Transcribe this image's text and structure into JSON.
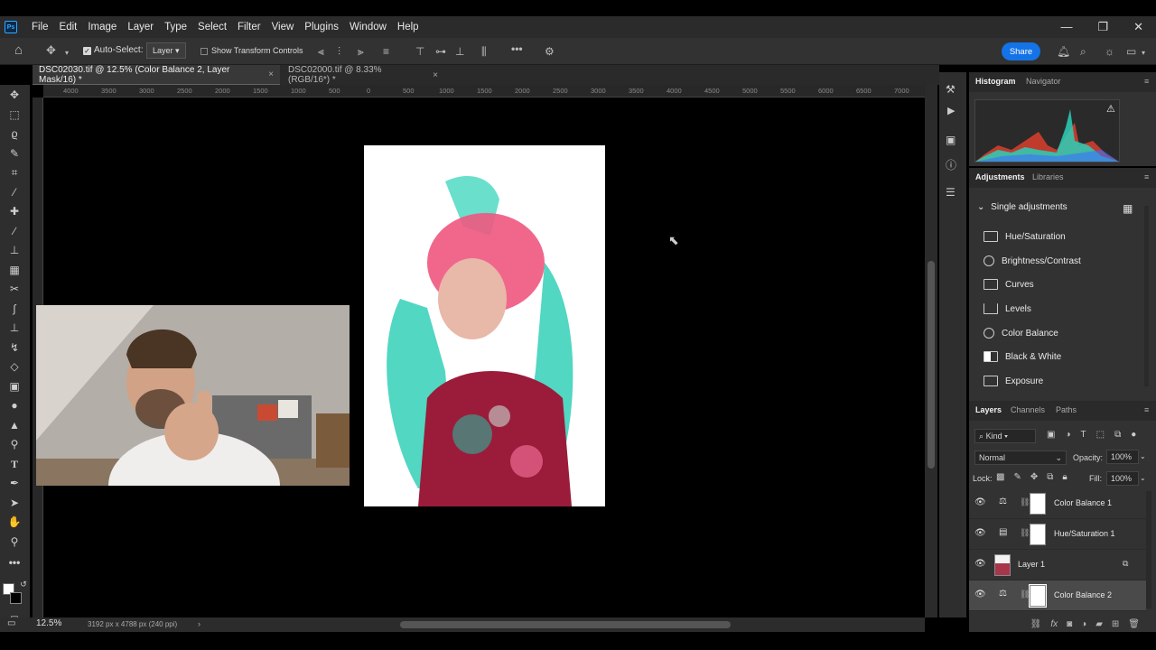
{
  "app": {
    "logo_text": "Ps"
  },
  "menu": [
    "File",
    "Edit",
    "Image",
    "Layer",
    "Type",
    "Select",
    "Filter",
    "View",
    "Plugins",
    "Window",
    "Help"
  ],
  "window_controls": {
    "minimize": "—",
    "restore": "❐",
    "close": "✕"
  },
  "options_bar": {
    "auto_select_label": "Auto-Select:",
    "auto_select_checked": true,
    "target_value": "Layer",
    "show_transform_label": "Show Transform Controls",
    "share_label": "Share"
  },
  "tabs": [
    {
      "label": "DSC02030.tif @ 12.5% (Color Balance 2, Layer Mask/16) *",
      "close": "×"
    },
    {
      "label": "DSC02000.tif @ 8.33% (RGB/16*) *",
      "close": "×"
    }
  ],
  "ruler_labels": [
    "4000",
    "3500",
    "3000",
    "2500",
    "2000",
    "1500",
    "1000",
    "500",
    "0",
    "500",
    "1000",
    "1500",
    "2000",
    "2500",
    "3000",
    "3500",
    "4000",
    "4500",
    "5000",
    "5500",
    "6000",
    "6500",
    "7000"
  ],
  "status": {
    "zoom": "12.5%",
    "doc_info": "3192 px x 4788 px (240 ppi)"
  },
  "histogram_panel": {
    "tabs": [
      "Histogram",
      "Navigator"
    ],
    "warning_icon": "warning-icon"
  },
  "adjustments_panel": {
    "tabs": [
      "Adjustments",
      "Libraries"
    ],
    "section_title": "Single adjustments",
    "items": [
      "Hue/Saturation",
      "Brightness/Contrast",
      "Curves",
      "Levels",
      "Color Balance",
      "Black & White",
      "Exposure"
    ]
  },
  "layers_panel": {
    "tabs": [
      "Layers",
      "Channels",
      "Paths"
    ],
    "filter_kind": "Kind",
    "blend_mode": "Normal",
    "opacity_label": "Opacity:",
    "opacity_value": "100%",
    "lock_label": "Lock:",
    "fill_label": "Fill:",
    "fill_value": "100%",
    "layers": [
      {
        "name": "Color Balance 1",
        "type": "adjustment",
        "selected": false
      },
      {
        "name": "Hue/Saturation 1",
        "type": "adjustment",
        "selected": false
      },
      {
        "name": "Layer 1",
        "type": "pixel",
        "selected": false
      },
      {
        "name": "Color Balance 2",
        "type": "adjustment",
        "selected": true
      }
    ]
  },
  "colors": {
    "accent": "#1473e6",
    "panel_bg": "#323232",
    "canvas_bg": "#000000"
  }
}
